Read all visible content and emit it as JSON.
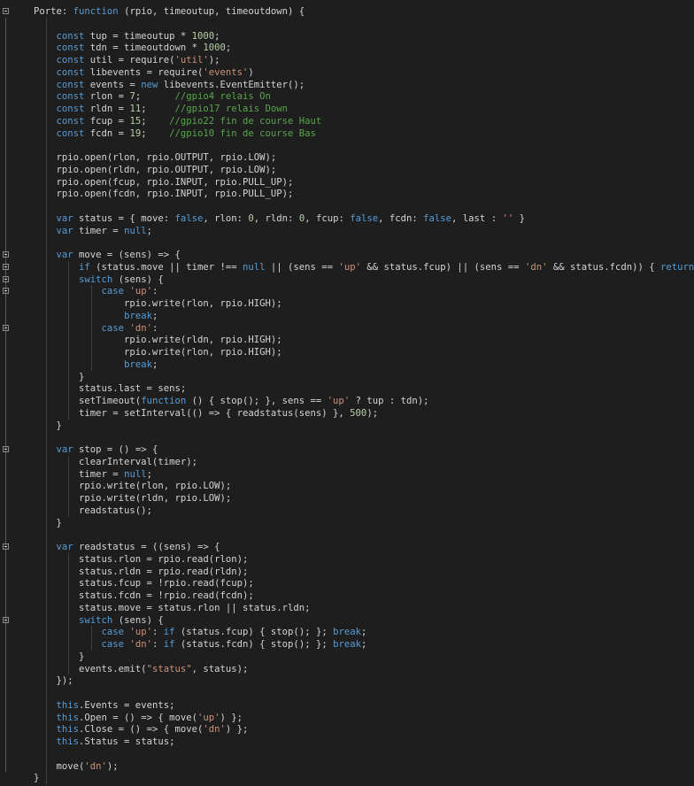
{
  "editor": {
    "colors": {
      "background": "#1e1e1e",
      "keyword": "#569cd6",
      "string": "#ce9178",
      "number": "#b5cea8",
      "comment": "#57a64a",
      "text": "#d4d4d4"
    },
    "lines": [
      {
        "fold": true,
        "tokens": [
          [
            "Porte: ",
            "id"
          ],
          [
            "function",
            "kw"
          ],
          [
            " (rpio, timeoutup, timeoutdown) {",
            "id"
          ]
        ]
      },
      {
        "tokens": []
      },
      {
        "tokens": [
          [
            "    ",
            "id"
          ],
          [
            "const",
            "kw"
          ],
          [
            " tup = timeoutup * ",
            "id"
          ],
          [
            "1000",
            "num"
          ],
          [
            ";",
            "id"
          ]
        ]
      },
      {
        "tokens": [
          [
            "    ",
            "id"
          ],
          [
            "const",
            "kw"
          ],
          [
            " tdn = timeoutdown * ",
            "id"
          ],
          [
            "1000",
            "num"
          ],
          [
            ";",
            "id"
          ]
        ]
      },
      {
        "tokens": [
          [
            "    ",
            "id"
          ],
          [
            "const",
            "kw"
          ],
          [
            " util = require(",
            "id"
          ],
          [
            "'util'",
            "str"
          ],
          [
            ");",
            "id"
          ]
        ]
      },
      {
        "tokens": [
          [
            "    ",
            "id"
          ],
          [
            "const",
            "kw"
          ],
          [
            " libevents = require(",
            "id"
          ],
          [
            "'events'",
            "str"
          ],
          [
            ")",
            "id"
          ]
        ]
      },
      {
        "tokens": [
          [
            "    ",
            "id"
          ],
          [
            "const",
            "kw"
          ],
          [
            " events = ",
            "id"
          ],
          [
            "new",
            "kw"
          ],
          [
            " libevents.EventEmitter();",
            "id"
          ]
        ]
      },
      {
        "tokens": [
          [
            "    ",
            "id"
          ],
          [
            "const",
            "kw"
          ],
          [
            " rlon = ",
            "id"
          ],
          [
            "7",
            "num"
          ],
          [
            ";      ",
            "id"
          ],
          [
            "//gpio4 relais On",
            "cm"
          ]
        ]
      },
      {
        "tokens": [
          [
            "    ",
            "id"
          ],
          [
            "const",
            "kw"
          ],
          [
            " rldn = ",
            "id"
          ],
          [
            "11",
            "num"
          ],
          [
            ";     ",
            "id"
          ],
          [
            "//gpio17 relais Down",
            "cm"
          ]
        ]
      },
      {
        "tokens": [
          [
            "    ",
            "id"
          ],
          [
            "const",
            "kw"
          ],
          [
            " fcup = ",
            "id"
          ],
          [
            "15",
            "num"
          ],
          [
            ";    ",
            "id"
          ],
          [
            "//gpio22 fin de course Haut",
            "cm"
          ]
        ]
      },
      {
        "tokens": [
          [
            "    ",
            "id"
          ],
          [
            "const",
            "kw"
          ],
          [
            " fcdn = ",
            "id"
          ],
          [
            "19",
            "num"
          ],
          [
            ";    ",
            "id"
          ],
          [
            "//gpio10 fin de course Bas",
            "cm"
          ]
        ]
      },
      {
        "tokens": []
      },
      {
        "tokens": [
          [
            "    rpio.open(rlon, rpio.OUTPUT, rpio.LOW);",
            "id"
          ]
        ]
      },
      {
        "tokens": [
          [
            "    rpio.open(rldn, rpio.OUTPUT, rpio.LOW);",
            "id"
          ]
        ]
      },
      {
        "tokens": [
          [
            "    rpio.open(fcup, rpio.INPUT, rpio.PULL_UP);",
            "id"
          ]
        ]
      },
      {
        "tokens": [
          [
            "    rpio.open(fcdn, rpio.INPUT, rpio.PULL_UP);",
            "id"
          ]
        ]
      },
      {
        "tokens": []
      },
      {
        "tokens": [
          [
            "    ",
            "id"
          ],
          [
            "var",
            "kw"
          ],
          [
            " status = { move: ",
            "id"
          ],
          [
            "false",
            "kw"
          ],
          [
            ", rlon: ",
            "id"
          ],
          [
            "0",
            "num"
          ],
          [
            ", rldn: ",
            "id"
          ],
          [
            "0",
            "num"
          ],
          [
            ", fcup: ",
            "id"
          ],
          [
            "false",
            "kw"
          ],
          [
            ", fcdn: ",
            "id"
          ],
          [
            "false",
            "kw"
          ],
          [
            ", last : ",
            "id"
          ],
          [
            "''",
            "str"
          ],
          [
            " }",
            "id"
          ]
        ]
      },
      {
        "tokens": [
          [
            "    ",
            "id"
          ],
          [
            "var",
            "kw"
          ],
          [
            " timer = ",
            "id"
          ],
          [
            "null",
            "kw"
          ],
          [
            ";",
            "id"
          ]
        ]
      },
      {
        "tokens": []
      },
      {
        "fold": true,
        "tokens": [
          [
            "    ",
            "id"
          ],
          [
            "var",
            "kw"
          ],
          [
            " move = (sens) => {",
            "id"
          ]
        ]
      },
      {
        "fold": true,
        "tokens": [
          [
            "        ",
            "id"
          ],
          [
            "if",
            "kw"
          ],
          [
            " (status.move || timer !== ",
            "id"
          ],
          [
            "null",
            "kw"
          ],
          [
            " || (sens == ",
            "id"
          ],
          [
            "'up'",
            "str"
          ],
          [
            " && status.fcup) || (sens == ",
            "id"
          ],
          [
            "'dn'",
            "str"
          ],
          [
            " && status.fcdn)) { ",
            "id"
          ],
          [
            "return",
            "kw"
          ],
          [
            "; }",
            "id"
          ]
        ]
      },
      {
        "fold": true,
        "tokens": [
          [
            "        ",
            "id"
          ],
          [
            "switch",
            "kw"
          ],
          [
            " (sens) {",
            "id"
          ]
        ]
      },
      {
        "fold": true,
        "tokens": [
          [
            "            ",
            "id"
          ],
          [
            "case",
            "kw"
          ],
          [
            " ",
            "id"
          ],
          [
            "'up'",
            "str"
          ],
          [
            ":",
            "id"
          ]
        ]
      },
      {
        "tokens": [
          [
            "                rpio.write(rlon, rpio.HIGH);",
            "id"
          ]
        ]
      },
      {
        "tokens": [
          [
            "                ",
            "id"
          ],
          [
            "break",
            "kw"
          ],
          [
            ";",
            "id"
          ]
        ]
      },
      {
        "fold": true,
        "tokens": [
          [
            "            ",
            "id"
          ],
          [
            "case",
            "kw"
          ],
          [
            " ",
            "id"
          ],
          [
            "'dn'",
            "str"
          ],
          [
            ":",
            "id"
          ]
        ]
      },
      {
        "tokens": [
          [
            "                rpio.write(rldn, rpio.HIGH);",
            "id"
          ]
        ]
      },
      {
        "tokens": [
          [
            "                rpio.write(rlon, rpio.HIGH);",
            "id"
          ]
        ]
      },
      {
        "tokens": [
          [
            "                ",
            "id"
          ],
          [
            "break",
            "kw"
          ],
          [
            ";",
            "id"
          ]
        ]
      },
      {
        "tokens": [
          [
            "        }",
            "id"
          ]
        ]
      },
      {
        "tokens": [
          [
            "        status.last = sens;",
            "id"
          ]
        ]
      },
      {
        "tokens": [
          [
            "        setTimeout(",
            "id"
          ],
          [
            "function",
            "kw"
          ],
          [
            " () { stop(); }, sens == ",
            "id"
          ],
          [
            "'up'",
            "str"
          ],
          [
            " ? tup : tdn);",
            "id"
          ]
        ]
      },
      {
        "tokens": [
          [
            "        timer = setInterval(() => { readstatus(sens) }, ",
            "id"
          ],
          [
            "500",
            "num"
          ],
          [
            ");",
            "id"
          ]
        ]
      },
      {
        "tokens": [
          [
            "    }",
            "id"
          ]
        ]
      },
      {
        "tokens": []
      },
      {
        "fold": true,
        "tokens": [
          [
            "    ",
            "id"
          ],
          [
            "var",
            "kw"
          ],
          [
            " stop = () => {",
            "id"
          ]
        ]
      },
      {
        "tokens": [
          [
            "        clearInterval(timer);",
            "id"
          ]
        ]
      },
      {
        "tokens": [
          [
            "        timer = ",
            "id"
          ],
          [
            "null",
            "kw"
          ],
          [
            ";",
            "id"
          ]
        ]
      },
      {
        "tokens": [
          [
            "        rpio.write(rlon, rpio.LOW);",
            "id"
          ]
        ]
      },
      {
        "tokens": [
          [
            "        rpio.write(rldn, rpio.LOW);",
            "id"
          ]
        ]
      },
      {
        "tokens": [
          [
            "        readstatus();",
            "id"
          ]
        ]
      },
      {
        "tokens": [
          [
            "    }",
            "id"
          ]
        ]
      },
      {
        "tokens": []
      },
      {
        "fold": true,
        "tokens": [
          [
            "    ",
            "id"
          ],
          [
            "var",
            "kw"
          ],
          [
            " readstatus = ((sens) => {",
            "id"
          ]
        ]
      },
      {
        "tokens": [
          [
            "        status.rlon = rpio.read(rlon);",
            "id"
          ]
        ]
      },
      {
        "tokens": [
          [
            "        status.rldn = rpio.read(rldn);",
            "id"
          ]
        ]
      },
      {
        "tokens": [
          [
            "        status.fcup = !rpio.read(fcup);",
            "id"
          ]
        ]
      },
      {
        "tokens": [
          [
            "        status.fcdn = !rpio.read(fcdn);",
            "id"
          ]
        ]
      },
      {
        "tokens": [
          [
            "        status.move = status.rlon || status.rldn;",
            "id"
          ]
        ]
      },
      {
        "fold": true,
        "tokens": [
          [
            "        ",
            "id"
          ],
          [
            "switch",
            "kw"
          ],
          [
            " (sens) {",
            "id"
          ]
        ]
      },
      {
        "tokens": [
          [
            "            ",
            "id"
          ],
          [
            "case",
            "kw"
          ],
          [
            " ",
            "id"
          ],
          [
            "'up'",
            "str"
          ],
          [
            ": ",
            "id"
          ],
          [
            "if",
            "kw"
          ],
          [
            " (status.fcup) { stop(); }; ",
            "id"
          ],
          [
            "break",
            "kw"
          ],
          [
            ";",
            "id"
          ]
        ]
      },
      {
        "tokens": [
          [
            "            ",
            "id"
          ],
          [
            "case",
            "kw"
          ],
          [
            " ",
            "id"
          ],
          [
            "'dn'",
            "str"
          ],
          [
            ": ",
            "id"
          ],
          [
            "if",
            "kw"
          ],
          [
            " (status.fcdn) { stop(); }; ",
            "id"
          ],
          [
            "break",
            "kw"
          ],
          [
            ";",
            "id"
          ]
        ]
      },
      {
        "tokens": [
          [
            "        }",
            "id"
          ]
        ]
      },
      {
        "tokens": [
          [
            "        events.emit(",
            "id"
          ],
          [
            "\"status\"",
            "str"
          ],
          [
            ", status);",
            "id"
          ]
        ]
      },
      {
        "tokens": [
          [
            "    });",
            "id"
          ]
        ]
      },
      {
        "tokens": []
      },
      {
        "tokens": [
          [
            "    ",
            "id"
          ],
          [
            "this",
            "kw"
          ],
          [
            ".Events = events;",
            "id"
          ]
        ]
      },
      {
        "tokens": [
          [
            "    ",
            "id"
          ],
          [
            "this",
            "kw"
          ],
          [
            ".Open = () => { move(",
            "id"
          ],
          [
            "'up'",
            "str"
          ],
          [
            ") };",
            "id"
          ]
        ]
      },
      {
        "tokens": [
          [
            "    ",
            "id"
          ],
          [
            "this",
            "kw"
          ],
          [
            ".Close = () => { move(",
            "id"
          ],
          [
            "'dn'",
            "str"
          ],
          [
            ") };",
            "id"
          ]
        ]
      },
      {
        "tokens": [
          [
            "    ",
            "id"
          ],
          [
            "this",
            "kw"
          ],
          [
            ".Status = status;",
            "id"
          ]
        ]
      },
      {
        "tokens": []
      },
      {
        "tokens": [
          [
            "    move(",
            "id"
          ],
          [
            "'dn'",
            "str"
          ],
          [
            ");",
            "id"
          ]
        ]
      },
      {
        "tokens": [
          [
            "}",
            "id"
          ]
        ]
      }
    ]
  }
}
